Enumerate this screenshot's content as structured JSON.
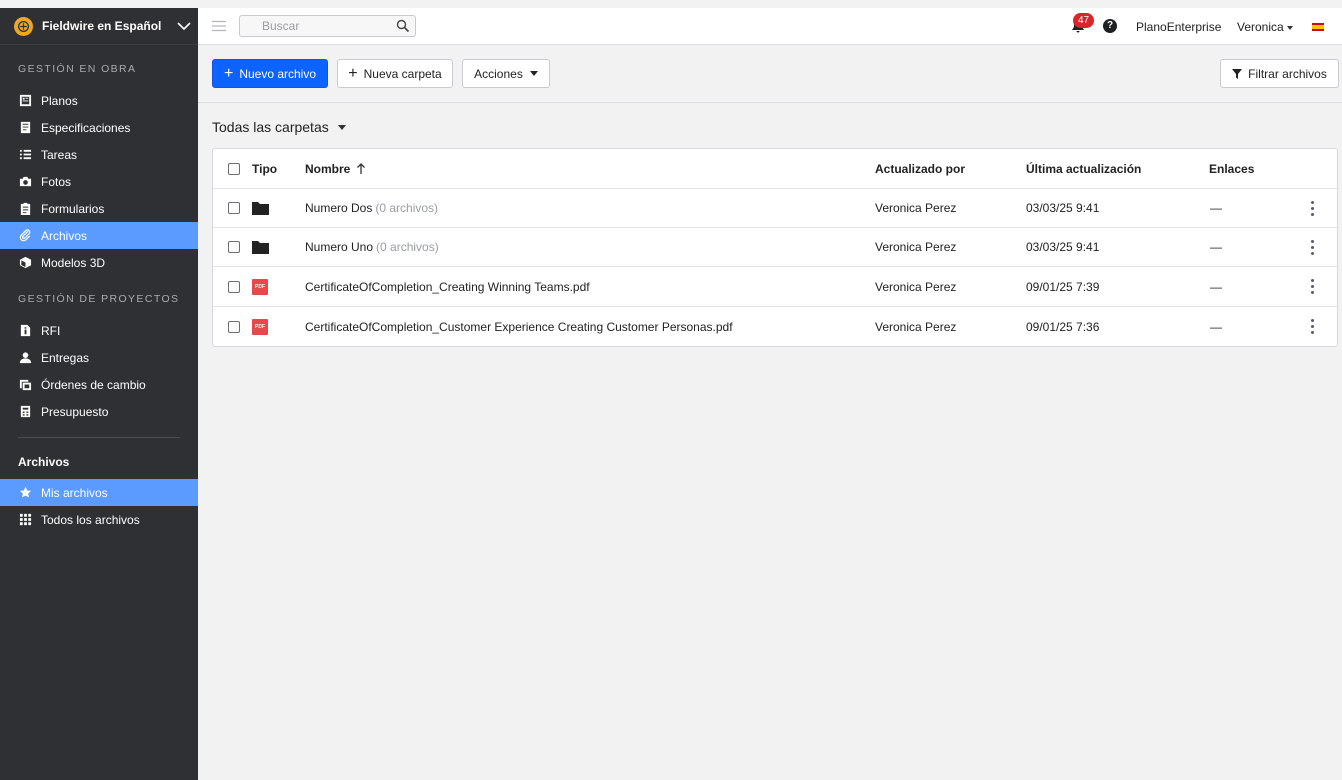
{
  "sidebar": {
    "project_name": "Fieldwire en Español",
    "section_obra": "GESTIÓN EN OBRA",
    "obra_items": [
      {
        "label": "Planos",
        "icon": "plans-icon"
      },
      {
        "label": "Especificaciones",
        "icon": "specs-icon"
      },
      {
        "label": "Tareas",
        "icon": "tasks-icon"
      },
      {
        "label": "Fotos",
        "icon": "camera-icon"
      },
      {
        "label": "Formularios",
        "icon": "clipboard-icon"
      },
      {
        "label": "Archivos",
        "icon": "paperclip-icon",
        "active": true
      },
      {
        "label": "Modelos 3D",
        "icon": "cube-icon"
      }
    ],
    "section_proyectos": "GESTIÓN DE PROYECTOS",
    "proyecto_items": [
      {
        "label": "RFI",
        "icon": "rfi-icon"
      },
      {
        "label": "Entregas",
        "icon": "submittals-icon"
      },
      {
        "label": "Órdenes de cambio",
        "icon": "change-orders-icon"
      },
      {
        "label": "Presupuesto",
        "icon": "calculator-icon"
      }
    ],
    "files_title": "Archivos",
    "files_items": [
      {
        "label": "Mis archivos",
        "icon": "star-icon",
        "active": true
      },
      {
        "label": "Todos los archivos",
        "icon": "grid-icon"
      }
    ]
  },
  "topbar": {
    "search_placeholder": "Buscar",
    "notification_count": "47",
    "help_label": "?",
    "org_name": "PlanoEnterprise",
    "user_name": "Veronica",
    "language_flag": "es-flag-icon"
  },
  "toolbar": {
    "new_file": "Nuevo archivo",
    "new_folder": "Nueva carpeta",
    "actions": "Acciones",
    "filter": "Filtrar archivos"
  },
  "content": {
    "folder_selector": "Todas las carpetas"
  },
  "table": {
    "headers": {
      "type": "Tipo",
      "name": "Nombre",
      "updated_by": "Actualizado por",
      "last_update": "Última actualización",
      "links": "Enlaces"
    },
    "rows": [
      {
        "type": "folder",
        "name": "Numero Dos",
        "suffix": "(0 archivos)",
        "updated_by": "Veronica Perez",
        "date": "03/03/25 9:41",
        "links": "—"
      },
      {
        "type": "folder",
        "name": "Numero Uno",
        "suffix": "(0 archivos)",
        "updated_by": "Veronica Perez",
        "date": "03/03/25 9:41",
        "links": "—"
      },
      {
        "type": "pdf",
        "name": "CertificateOfCompletion_Creating Winning Teams.pdf",
        "suffix": "",
        "updated_by": "Veronica Perez",
        "date": "09/01/25 7:39",
        "links": "—"
      },
      {
        "type": "pdf",
        "name": "CertificateOfCompletion_Customer Experience Creating Customer Personas.pdf",
        "suffix": "",
        "updated_by": "Veronica Perez",
        "date": "09/01/25 7:36",
        "links": "—"
      }
    ],
    "pdf_badge": "PDF"
  },
  "colors": {
    "sidebar_bg": "#2e3033",
    "active_item": "#5b9bff",
    "primary_button": "#0d63ff",
    "badge": "#d9242b",
    "pdf": "#e8474c"
  }
}
